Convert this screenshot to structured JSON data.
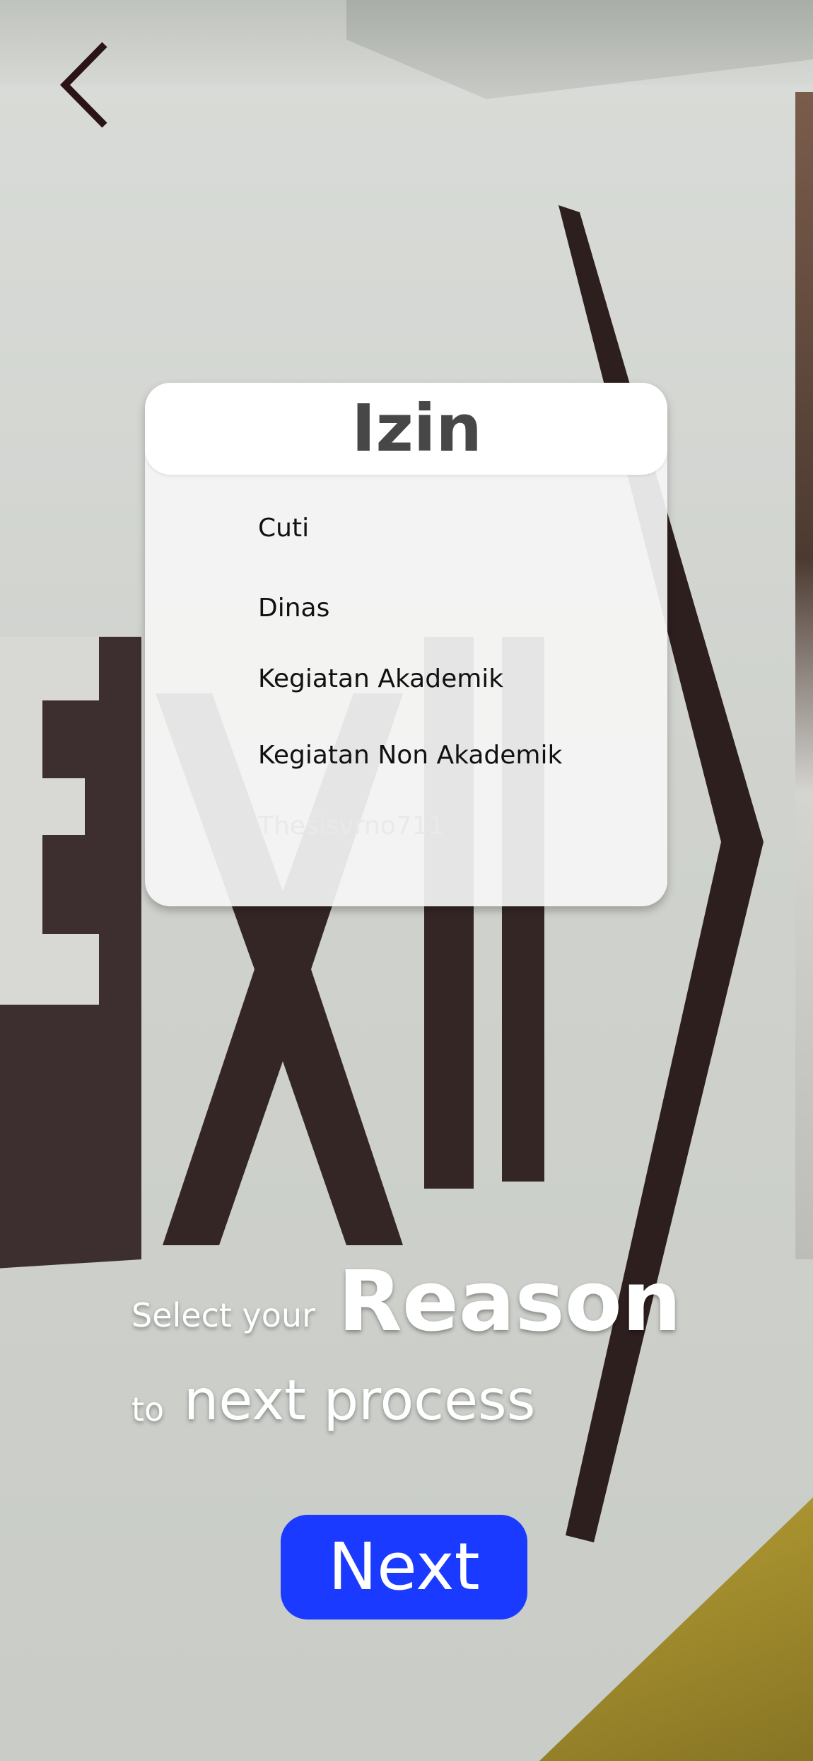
{
  "panel": {
    "title": "Izin",
    "items": [
      {
        "label": "Cuti"
      },
      {
        "label": "Dinas"
      },
      {
        "label": "Kegiatan Akademik"
      },
      {
        "label": "Kegiatan Non Akademik"
      },
      {
        "label": "Thesisvrno711"
      }
    ]
  },
  "caption": {
    "line1_small": "Select your",
    "line1_big": "Reason",
    "line2_small": "to",
    "line2_big": "next process"
  },
  "buttons": {
    "next_label": "Next",
    "back_icon": "chevron-left-icon"
  },
  "colors": {
    "accent": "#1a3bff",
    "panel_title": "#474747",
    "back_icon": "#2b1418"
  }
}
